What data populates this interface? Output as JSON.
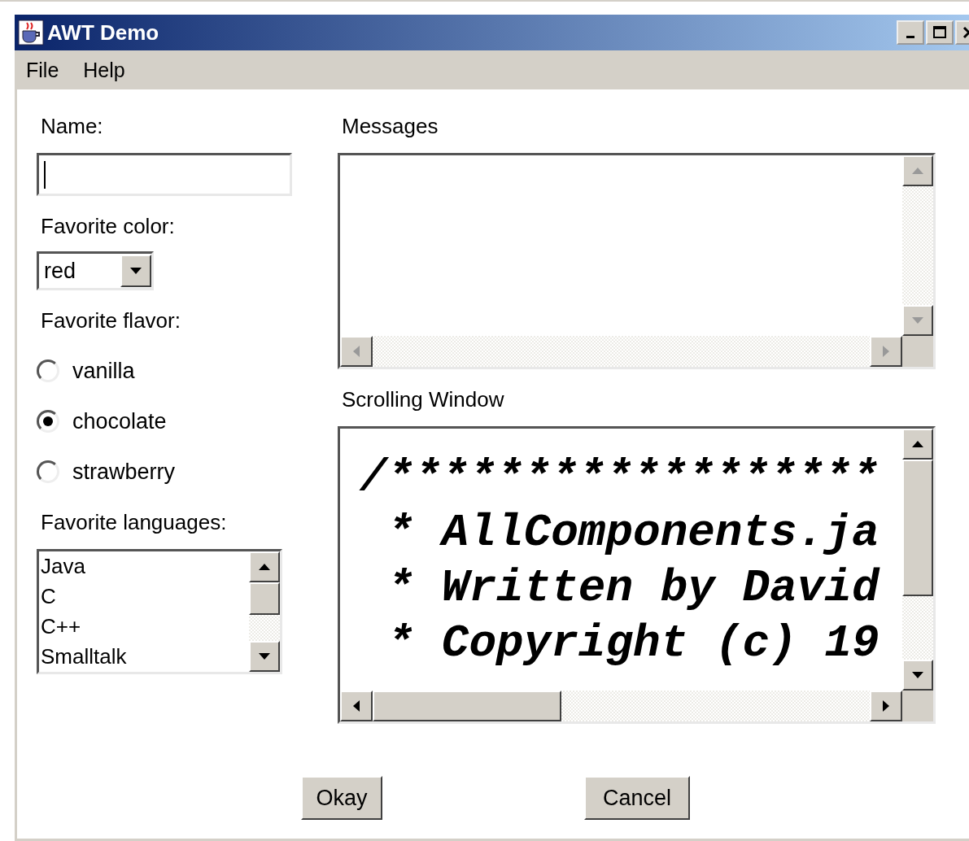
{
  "window": {
    "title": "AWT Demo"
  },
  "menu": [
    "File",
    "Help"
  ],
  "name_field": {
    "label": "Name:"
  },
  "color_select": {
    "label": "Favorite color:",
    "value": "red"
  },
  "flavor": {
    "label": "Favorite flavor:",
    "options": [
      {
        "label": "vanilla",
        "selected": false
      },
      {
        "label": "chocolate",
        "selected": true
      },
      {
        "label": "strawberry",
        "selected": false
      }
    ]
  },
  "languages": {
    "label": "Favorite languages:",
    "items": [
      "Java",
      "C",
      "C++",
      "Smalltalk"
    ]
  },
  "messages": {
    "label": "Messages"
  },
  "scrolling_window": {
    "label": "Scrolling Window",
    "lines": [
      "/******************",
      " * AllComponents.ja",
      " * Written by David",
      " * Copyright (c) 19"
    ]
  },
  "buttons": [
    "Okay",
    "Cancel"
  ]
}
